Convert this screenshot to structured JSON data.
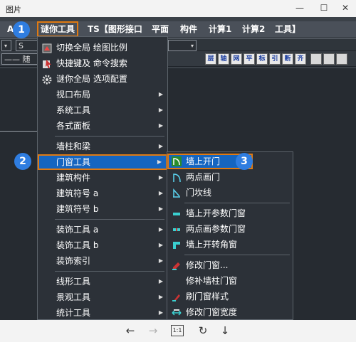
{
  "window": {
    "title": "图片",
    "minimize": "—",
    "maximize": "☐",
    "close": "✕"
  },
  "menubar": {
    "items": [
      "A",
      "谜你工具",
      "TS【图形接口",
      "平面",
      "构件",
      "计算1",
      "计算2",
      "工具】"
    ]
  },
  "toolbar": {
    "field1": "▾",
    "field2": "S",
    "field3": "—— 随",
    "field4": "▾",
    "icons": [
      "层",
      "轴",
      "网",
      "平",
      "标",
      "引",
      "断",
      "齐"
    ]
  },
  "menu1": {
    "items": [
      {
        "label": "切换全局 绘图比例",
        "icon": "scale-icon",
        "arrow": false
      },
      {
        "label": "快捷键及 命令搜索",
        "icon": "shortcut-icon",
        "arrow": false
      },
      {
        "label": "谜你全局 选项配置",
        "icon": "gear-icon",
        "arrow": false
      },
      {
        "label": "视口布局",
        "arrow": true
      },
      {
        "label": "系统工具",
        "arrow": true
      },
      {
        "label": "各式面板",
        "arrow": true
      },
      {
        "label": "墙柱和梁",
        "arrow": true
      },
      {
        "label": "门窗工具",
        "arrow": true
      },
      {
        "label": "建筑构件",
        "arrow": true
      },
      {
        "label": "建筑符号 a",
        "arrow": true
      },
      {
        "label": "建筑符号 b",
        "arrow": true
      },
      {
        "label": "装饰工具 a",
        "arrow": true
      },
      {
        "label": "装饰工具 b",
        "arrow": true
      },
      {
        "label": "装饰索引",
        "arrow": true
      },
      {
        "label": "线形工具",
        "arrow": true
      },
      {
        "label": "景观工具",
        "arrow": true
      },
      {
        "label": "统计工具",
        "arrow": true
      }
    ],
    "arrow_glyph": "▶"
  },
  "menu2": {
    "items": [
      {
        "label": "墙上开门",
        "icon": "wall-door-icon"
      },
      {
        "label": "两点画门",
        "icon": "two-point-door-icon"
      },
      {
        "label": "门坎线",
        "icon": "door-sill-icon"
      },
      {
        "label": "墙上开参数门窗",
        "icon": "param-window-icon"
      },
      {
        "label": "两点画参数门窗",
        "icon": "two-point-window-icon"
      },
      {
        "label": "墙上开转角窗",
        "icon": "corner-window-icon"
      },
      {
        "label": "修改门窗...",
        "icon": "edit-window-icon"
      },
      {
        "label": "修补墙柱门窗",
        "icon": "repair-icon"
      },
      {
        "label": "刷门窗样式",
        "icon": "brush-icon"
      },
      {
        "label": "修改门窗宽度",
        "icon": "width-icon"
      }
    ]
  },
  "badges": [
    "1",
    "2",
    "3"
  ],
  "bottombar": {
    "back": "←",
    "forward": "→",
    "actual_size": "1:1",
    "rotate": "↻",
    "download": "↓"
  },
  "colors": {
    "highlight": "#1565c0",
    "accent_border": "#e07a12",
    "badge": "#2f7de0",
    "menu_bg": "#2c3138"
  }
}
